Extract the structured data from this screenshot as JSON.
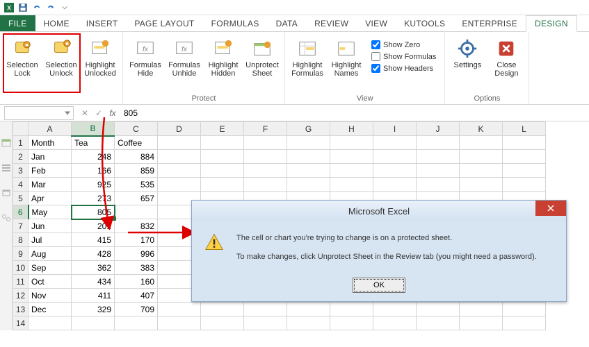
{
  "qat": {
    "items": [
      "save",
      "undo",
      "redo",
      "touch"
    ]
  },
  "tabs": [
    "FILE",
    "HOME",
    "INSERT",
    "PAGE LAYOUT",
    "FORMULAS",
    "DATA",
    "REVIEW",
    "VIEW",
    "KUTOOLS",
    "ENTERPRISE",
    "DESIGN"
  ],
  "active_tab": "DESIGN",
  "ribbon": {
    "groups": [
      {
        "label": "",
        "buttons": [
          "Selection\nLock",
          "Selection\nUnlock",
          "Highlight\nUnlocked"
        ]
      },
      {
        "label": "Protect",
        "buttons": [
          "Formulas\nHide",
          "Formulas\nUnhide",
          "Highlight\nHidden",
          "Unprotect\nSheet"
        ]
      },
      {
        "label": "View",
        "buttons": [
          "Highlight\nFormulas",
          "Highlight\nNames"
        ],
        "checks": [
          {
            "label": "Show Zero",
            "checked": true
          },
          {
            "label": "Show Formulas",
            "checked": false
          },
          {
            "label": "Show Headers",
            "checked": true
          }
        ]
      },
      {
        "label": "Options",
        "buttons": [
          "Settings",
          "Close\nDesign"
        ]
      }
    ]
  },
  "formula_bar": {
    "name_box": "",
    "value": "805"
  },
  "columns": [
    "A",
    "B",
    "C",
    "D",
    "E",
    "F",
    "G",
    "H",
    "I",
    "J",
    "K",
    "L"
  ],
  "rows": [
    {
      "n": 1,
      "cells": [
        "Month",
        "Tea",
        "Coffee"
      ],
      "txt": [
        0,
        1,
        2
      ]
    },
    {
      "n": 2,
      "cells": [
        "Jan",
        "248",
        "884"
      ],
      "txt": [
        0
      ]
    },
    {
      "n": 3,
      "cells": [
        "Feb",
        "166",
        "859"
      ],
      "txt": [
        0
      ]
    },
    {
      "n": 4,
      "cells": [
        "Mar",
        "925",
        "535"
      ],
      "txt": [
        0
      ]
    },
    {
      "n": 5,
      "cells": [
        "Apr",
        "273",
        "657"
      ],
      "txt": [
        0
      ]
    },
    {
      "n": 6,
      "cells": [
        "May",
        "805",
        ""
      ],
      "txt": [
        0
      ]
    },
    {
      "n": 7,
      "cells": [
        "Jun",
        "201",
        "832"
      ],
      "txt": [
        0
      ]
    },
    {
      "n": 8,
      "cells": [
        "Jul",
        "415",
        "170"
      ],
      "txt": [
        0
      ]
    },
    {
      "n": 9,
      "cells": [
        "Aug",
        "428",
        "996"
      ],
      "txt": [
        0
      ]
    },
    {
      "n": 10,
      "cells": [
        "Sep",
        "362",
        "383"
      ],
      "txt": [
        0
      ]
    },
    {
      "n": 11,
      "cells": [
        "Oct",
        "434",
        "160"
      ],
      "txt": [
        0
      ]
    },
    {
      "n": 12,
      "cells": [
        "Nov",
        "411",
        "407"
      ],
      "txt": [
        0
      ]
    },
    {
      "n": 13,
      "cells": [
        "Dec",
        "329",
        "709"
      ],
      "txt": [
        0
      ]
    },
    {
      "n": 14,
      "cells": [
        "",
        "",
        ""
      ],
      "txt": []
    }
  ],
  "selected": {
    "row": 6,
    "col": "B"
  },
  "dialog": {
    "title": "Microsoft Excel",
    "line1": "The cell or chart you're trying to change is on a protected sheet.",
    "line2": "To make changes, click Unprotect Sheet in the Review tab (you might need a password).",
    "ok": "OK"
  }
}
